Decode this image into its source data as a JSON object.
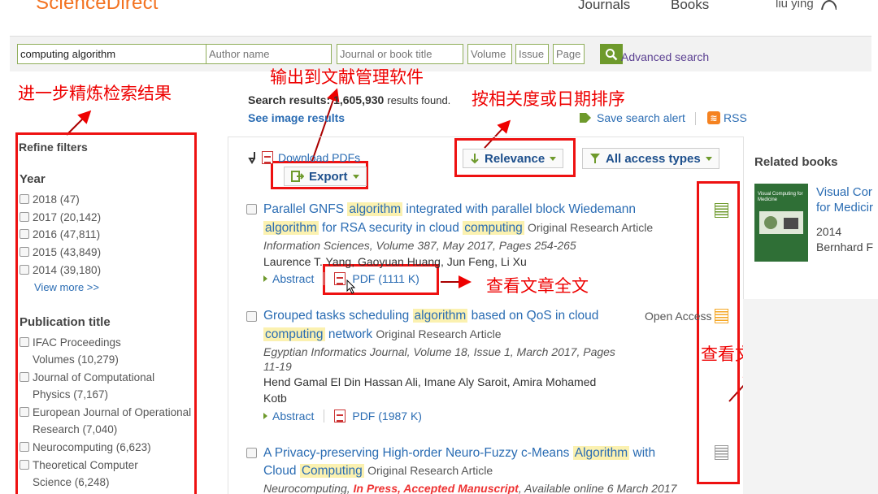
{
  "header": {
    "logo": "ScienceDirect",
    "nav": [
      "Journals",
      "Books"
    ],
    "user": "liu ying"
  },
  "search": {
    "terms_value": "computing algorithm",
    "author_placeholder": "Author name",
    "journal_placeholder": "Journal or book title",
    "volume_placeholder": "Volume",
    "issue_placeholder": "Issue",
    "page_placeholder": "Page",
    "advanced": "Advanced search"
  },
  "annotations": {
    "refine": "进一步精炼检索结果",
    "export": "输出到文献管理软件",
    "sort": "按相关度或日期排序",
    "fulltext": "查看文章全文",
    "access": "查看文章权限状态"
  },
  "sidebar": {
    "heading": "Refine filters",
    "year_heading": "Year",
    "years": [
      {
        "label": "2018 (47)"
      },
      {
        "label": "2017 (20,142)"
      },
      {
        "label": "2016 (47,811)"
      },
      {
        "label": "2015 (43,849)"
      },
      {
        "label": "2014 (39,180)"
      }
    ],
    "view_more": "View more >>",
    "pub_heading": "Publication title",
    "pubs": [
      {
        "line1": "IFAC Proceedings",
        "line2": "Volumes (10,279)"
      },
      {
        "line1": "Journal of Computational",
        "line2": "Physics (7,167)"
      },
      {
        "line1": "European Journal of Operational",
        "line2": "Research (7,040)"
      },
      {
        "line1": "Neurocomputing (6,623)",
        "line2": ""
      },
      {
        "line1": "Theoretical Computer",
        "line2": "Science (6,248)"
      }
    ]
  },
  "results": {
    "stat_label": "Search results:",
    "stat_count": "1,605,930",
    "stat_suffix": "results found.",
    "image_link": "See image results",
    "save_alert": "Save search alert",
    "rss": "RSS",
    "download": "Download PDFs",
    "export": "Export",
    "sort": "Relevance",
    "access_filter": "All access types",
    "items": [
      {
        "t1a": "Parallel GNFS ",
        "t1b": "algorithm",
        "t1c": " integrated with parallel block Wiedemann",
        "t2a": "algorithm",
        "t2b": " for RSA security in cloud ",
        "t2c": "computing",
        "type": "Original Research Article",
        "journal": "Information Sciences, Volume 387, May 2017, Pages 254-265",
        "authors": "Laurence T. Yang, Gaoyuan Huang, Jun Feng, Li Xu",
        "abstract": "Abstract",
        "pdf": "PDF (1111 K)"
      },
      {
        "t1a": "Grouped tasks scheduling ",
        "t1b": "algorithm",
        "t1c": " based on QoS in cloud",
        "t2a": "computing",
        "t2b": " network",
        "type": "Original Research Article",
        "journal": "Egyptian Informatics Journal, Volume 18, Issue 1, March 2017, Pages",
        "journal2": "11-19",
        "authors": "Hend Gamal El Din Hassan Ali, Imane Aly Saroit, Amira Mohamed",
        "authors2": "Kotb",
        "abstract": "Abstract",
        "pdf": "PDF (1987 K)",
        "open_access": "Open Access"
      },
      {
        "t1a": "A Privacy-preserving High-order Neuro-Fuzzy c-Means ",
        "t1b": "Algorithm",
        "t1c": " with",
        "t2a": "Cloud ",
        "t2b": "Computing",
        "type": "Original Research Article",
        "journal_a": "Neurocomputing, ",
        "journal_b": "In Press, Accepted Manuscript",
        "journal_c": ", Available online 6 March 2017"
      }
    ]
  },
  "related": {
    "heading": "Related books",
    "book_title1": "Visual Cor",
    "book_title2": "for Medicir",
    "book_year": "2014",
    "book_author": "Bernhard F",
    "cover_text": "Visual Computing for Medicine"
  },
  "colors": {
    "annotation": "#e00000",
    "link": "#2a6cb3",
    "highlight": "#fbf1b0",
    "brand": "#f37321",
    "green": "#6e9a2c"
  }
}
